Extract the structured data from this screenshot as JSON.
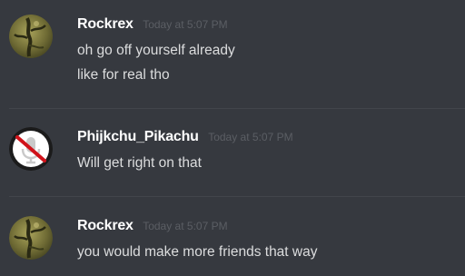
{
  "messages": [
    {
      "username": "Rockrex",
      "timestamp": "Today at 5:07 PM",
      "avatar_icon": "twisted-tree-avatar",
      "lines": [
        "oh go off yourself already",
        "like for real tho"
      ]
    },
    {
      "username": "Phijkchu_Pikachu",
      "timestamp": "Today at 5:07 PM",
      "avatar_icon": "muted-microphone-avatar",
      "lines": [
        "Will get right on that"
      ]
    },
    {
      "username": "Rockrex",
      "timestamp": "Today at 5:07 PM",
      "avatar_icon": "twisted-tree-avatar",
      "lines": [
        "you would make more friends that way"
      ]
    }
  ],
  "colors": {
    "background": "#36393f",
    "username": "#ffffff",
    "message_text": "#dcddde",
    "timestamp": "#5b5e64",
    "divider": "#42454b",
    "mute_slash": "#d0121a"
  }
}
